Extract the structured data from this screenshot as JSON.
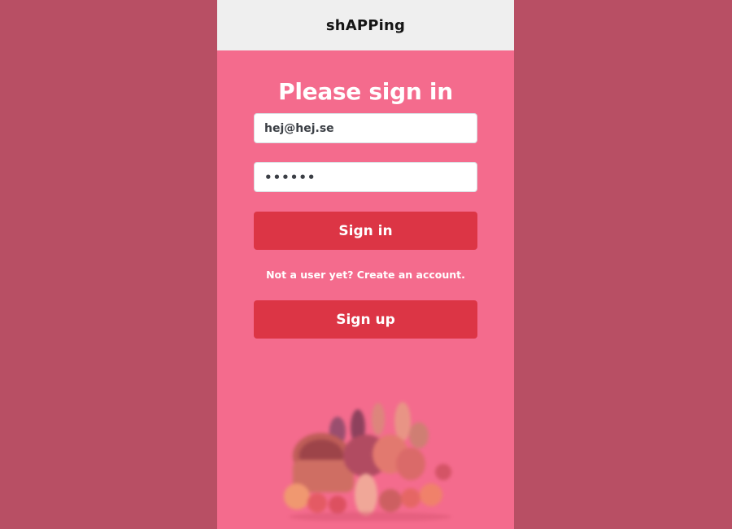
{
  "app": {
    "title": "shAPPing"
  },
  "signin": {
    "heading": "Please sign in",
    "email_value": "hej@hej.se",
    "password_value": "••••••",
    "signin_label": "Sign in",
    "note": "Not a user yet? Create an account.",
    "signup_label": "Sign up"
  },
  "colors": {
    "outer_background": "#b84f64",
    "app_background": "#f46b8d",
    "header_background": "#efefef",
    "button": "#dc3545"
  },
  "image": {
    "icon": "grocery-basket-image"
  }
}
